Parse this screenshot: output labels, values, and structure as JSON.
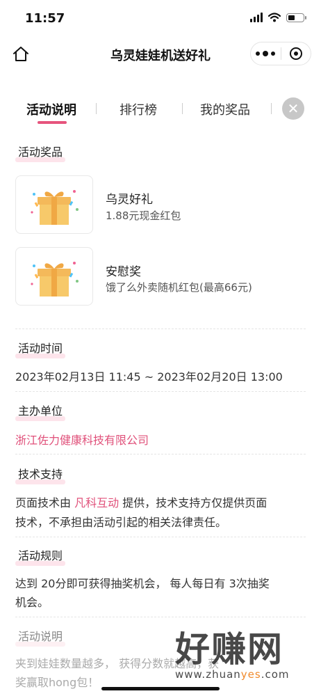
{
  "status": {
    "time": "11:57"
  },
  "nav": {
    "title": "乌灵娃娃机送好礼"
  },
  "tabs": [
    {
      "label": "活动说明",
      "active": true
    },
    {
      "label": "排行榜",
      "active": false
    },
    {
      "label": "我的奖品",
      "active": false
    }
  ],
  "sections": {
    "prizes_title": "活动奖品",
    "prizes": [
      {
        "name": "乌灵好礼",
        "desc": "1.88元现金红包",
        "icon": "gift-box-icon"
      },
      {
        "name": "安慰奖",
        "desc": "饿了么外卖随机红包(最高66元)",
        "icon": "gift-box-icon"
      }
    ],
    "time_title": "活动时间",
    "time_text": "2023年02月13日 11:45 ~ 2023年02月20日 13:00",
    "organizer_title": "主办单位",
    "organizer_text": "浙江佐力健康科技有限公司",
    "tech_title": "技术支持",
    "tech_line1_pre": "页面技术由 ",
    "tech_line1_link": "凡科互动",
    "tech_line1_post": " 提供，技术支持方仅提供页面",
    "tech_line2": "技术，不承担由活动引起的相关法律责任。",
    "rules_title": "活动规则",
    "rules_line1": "达到 20分即可获得抽奖机会， 每人每日有 3次抽奖",
    "rules_line2": "机会。",
    "desc_title": "活动说明",
    "desc_line1": "夹到娃娃数量越多， 获得分数就越高，获",
    "desc_line2": "奖赢取hong包！"
  },
  "watermark": {
    "big": "好赚网",
    "small_pre": "www.zhuan",
    "small_orange": "yes",
    "small_post": ".com"
  },
  "colors": {
    "accent": "#e6547d",
    "link": "#e0507a",
    "highlight": "#fde4eb"
  }
}
